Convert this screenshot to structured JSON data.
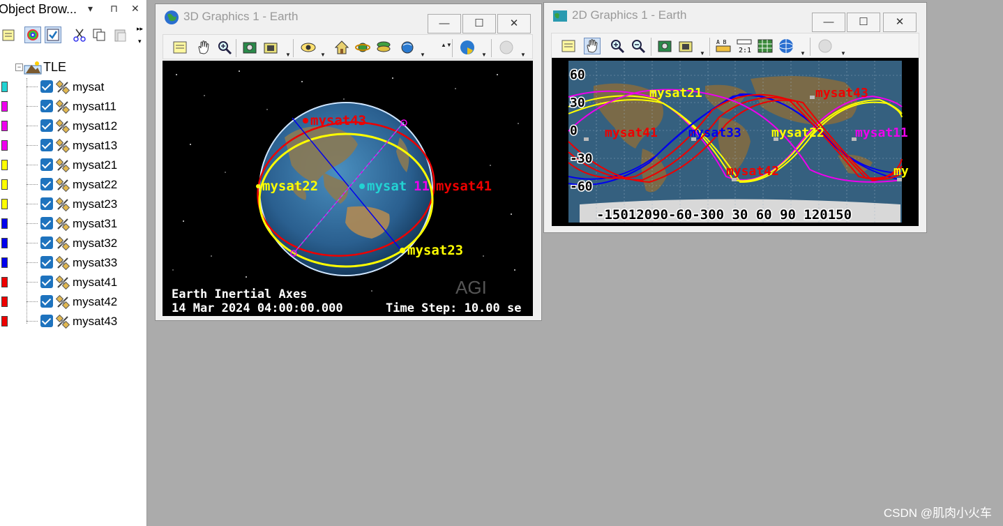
{
  "object_browser": {
    "title": "Object Brow...",
    "pin": "⊓",
    "close": "✕",
    "dropdown": "▾",
    "root_label": "TLE",
    "items": [
      {
        "label": "mysat",
        "color": "#22d3d3"
      },
      {
        "label": "mysat11",
        "color": "#ee00ee"
      },
      {
        "label": "mysat12",
        "color": "#ee00ee"
      },
      {
        "label": "mysat13",
        "color": "#ee00ee"
      },
      {
        "label": "mysat21",
        "color": "#ffff00"
      },
      {
        "label": "mysat22",
        "color": "#ffff00"
      },
      {
        "label": "mysat23",
        "color": "#ffff00"
      },
      {
        "label": "mysat31",
        "color": "#0000ee"
      },
      {
        "label": "mysat32",
        "color": "#0000ee"
      },
      {
        "label": "mysat33",
        "color": "#0000ee"
      },
      {
        "label": "mysat41",
        "color": "#ee0000"
      },
      {
        "label": "mysat42",
        "color": "#ee0000"
      },
      {
        "label": "mysat43",
        "color": "#ee0000"
      }
    ]
  },
  "window3d": {
    "title": "3D Graphics 1 - Earth",
    "minimize": "—",
    "maximize": "☐",
    "close": "✕",
    "overlay_line1": "Earth Inertial Axes",
    "overlay_date": "14 Mar 2024 04:00:00.000",
    "overlay_step": "Time Step: 10.00 se",
    "logo": "AGI",
    "labels": {
      "sat43": "mysat43",
      "sat22": "mysat22",
      "sat_center": "mysat",
      "sat11": "11",
      "sat41": "mysat41",
      "sat23": "mysat23"
    }
  },
  "window2d": {
    "title": "2D Graphics 1 - Earth",
    "minimize": "—",
    "maximize": "☐",
    "close": "✕",
    "lat_ticks": [
      "60",
      "30",
      "0",
      "-30",
      "-60"
    ],
    "lon_ticks": "-15012090-60-300  30  60  90  120150",
    "labels": {
      "sat21": "mysat21",
      "sat43": "mysat43",
      "sat41": "mysat41",
      "sat33": "mysat33",
      "sat22": "mysat22",
      "sat11": "mysat11",
      "sat42": "mysat42",
      "sat_edge": "my"
    }
  },
  "watermark": "CSDN @肌肉小火车",
  "colors": {
    "cyan": "#22d3d3",
    "magenta": "#ee00ee",
    "yellow": "#ffff00",
    "blue": "#0000ee",
    "red": "#ee0000",
    "workspace": "#ababab"
  }
}
